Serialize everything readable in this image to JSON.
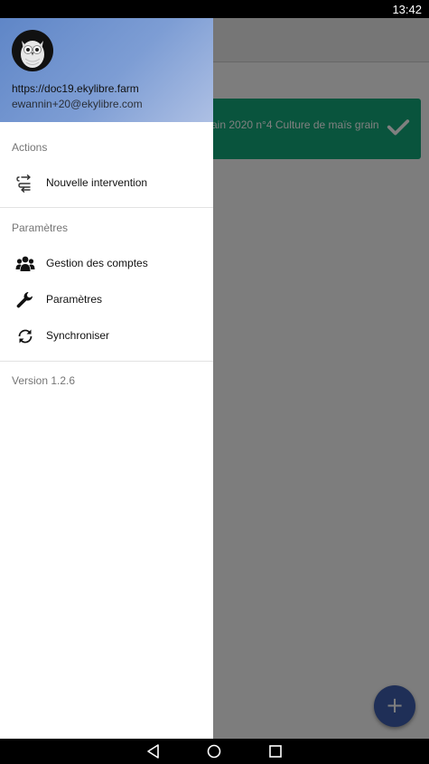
{
  "status_bar": {
    "time": "13:42"
  },
  "background": {
    "card_text": "ain 2020 n°4 Culture de maïs grain",
    "fab_label": "+"
  },
  "drawer": {
    "server": "https://doc19.ekylibre.farm",
    "email": "ewannin+20@ekylibre.com",
    "actions_title": "Actions",
    "actions": [
      {
        "label": "Nouvelle intervention",
        "icon": "route-icon"
      }
    ],
    "settings_title": "Paramètres",
    "settings": [
      {
        "label": "Gestion des comptes",
        "icon": "users-icon"
      },
      {
        "label": "Paramètres",
        "icon": "wrench-icon"
      },
      {
        "label": "Synchroniser",
        "icon": "sync-icon"
      }
    ],
    "version": "Version 1.2.6"
  },
  "colors": {
    "header_gradient_start": "#5f86c7",
    "header_gradient_end": "#aec0e4",
    "card": "#12a97a",
    "fab": "#3f5fae"
  }
}
